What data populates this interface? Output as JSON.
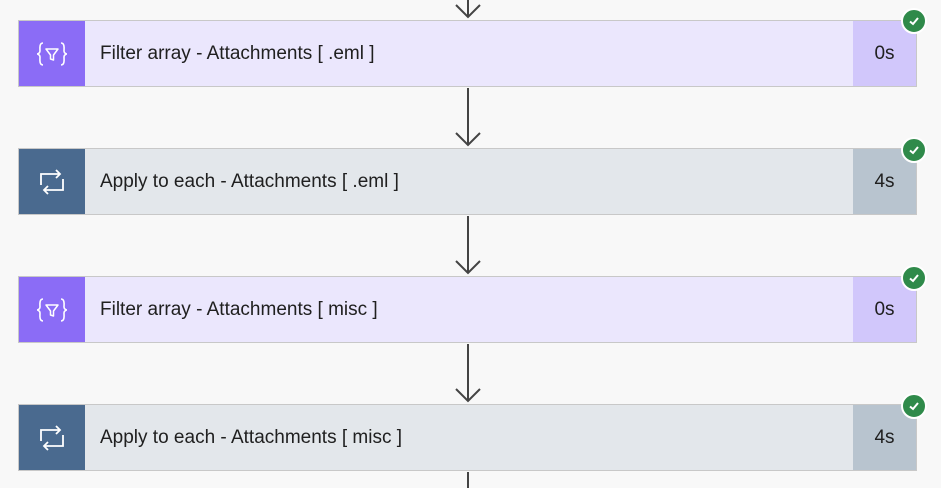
{
  "colors": {
    "filter_icon_bg": "#8b6cf6",
    "filter_card_bg": "#ebe7fd",
    "filter_duration_bg": "#d1c7fb",
    "loop_icon_bg": "#4a6a8f",
    "loop_card_bg": "#e3e7eb",
    "loop_duration_bg": "#b8c4cf",
    "success": "#2f8a4a"
  },
  "steps": [
    {
      "kind": "filter-array",
      "icon": "filter-array-icon",
      "title": "Filter array - Attachments [ .eml ]",
      "duration": "0s",
      "status": "succeeded"
    },
    {
      "kind": "apply-to-each",
      "icon": "loop-icon",
      "title": "Apply to each - Attachments [ .eml ]",
      "duration": "4s",
      "status": "succeeded"
    },
    {
      "kind": "filter-array",
      "icon": "filter-array-icon",
      "title": "Filter array - Attachments [ misc ]",
      "duration": "0s",
      "status": "succeeded"
    },
    {
      "kind": "apply-to-each",
      "icon": "loop-icon",
      "title": "Apply to each - Attachments [ misc ]",
      "duration": "4s",
      "status": "succeeded"
    }
  ]
}
